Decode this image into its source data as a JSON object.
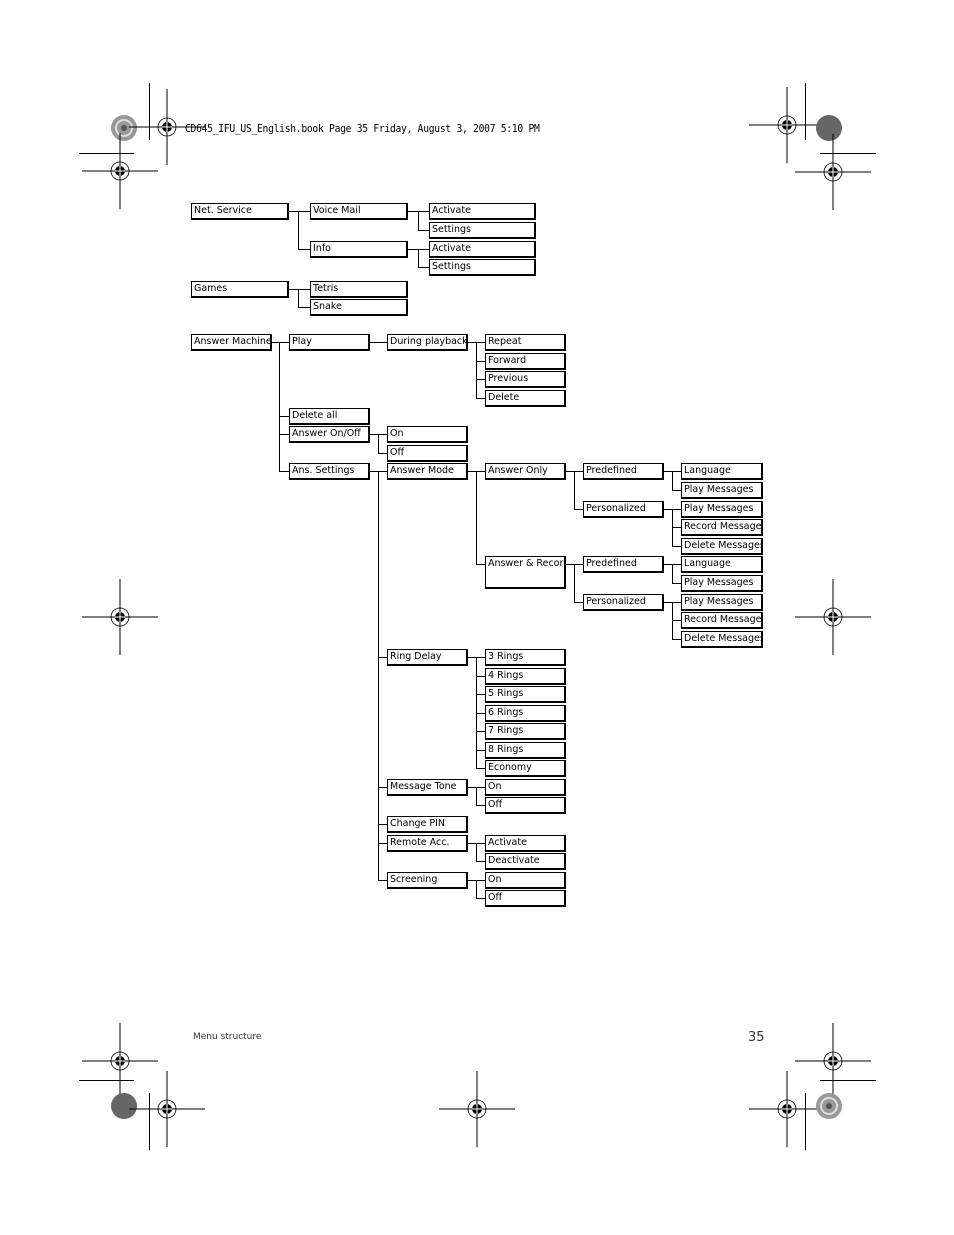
{
  "header": {
    "print_info": "CD645_IFU_US_English.book  Page 35  Friday, August 3, 2007  5:10 PM"
  },
  "menu": {
    "net_service": {
      "label": "Net. Service",
      "voice_mail": {
        "label": "Voice Mail",
        "children": [
          "Activate",
          "Settings"
        ]
      },
      "info": {
        "label": "Info",
        "children": [
          "Activate",
          "Settings"
        ]
      }
    },
    "games": {
      "label": "Games",
      "children": [
        "Tetris",
        "Snake"
      ]
    },
    "answer_machine": {
      "label": "Answer Machine",
      "play": {
        "label": "Play",
        "during_playback": {
          "label": "During playback",
          "children": [
            "Repeat",
            "Forward",
            "Previous",
            "Delete"
          ]
        }
      },
      "delete_all": "Delete all",
      "answer_on_off": {
        "label": "Answer On/Off",
        "children": [
          "On",
          "Off"
        ]
      },
      "ans_settings": {
        "label": "Ans. Settings",
        "answer_mode": {
          "label": "Answer Mode",
          "answer_only": {
            "label": "Answer Only",
            "predefined": {
              "label": "Predefined",
              "children": [
                "Language",
                "Play Messages"
              ]
            },
            "personalized": {
              "label": "Personalized",
              "children": [
                "Play Messages",
                "Record Messages",
                "Delete Messages"
              ]
            }
          },
          "answer_record": {
            "label": "Answer & Record",
            "predefined": {
              "label": "Predefined",
              "children": [
                "Language",
                "Play Messages"
              ]
            },
            "personalized": {
              "label": "Personalized",
              "children": [
                "Play Messages",
                "Record Messages",
                "Delete Messages"
              ]
            }
          }
        },
        "ring_delay": {
          "label": "Ring Delay",
          "children": [
            "3 Rings",
            "4 Rings",
            "5 Rings",
            "6 Rings",
            "7 Rings",
            "8 Rings",
            "Economy"
          ]
        },
        "message_tone": {
          "label": "Message Tone",
          "children": [
            "On",
            "Off"
          ]
        },
        "change_pin": "Change PIN",
        "remote_acc": {
          "label": "Remote Acc.",
          "children": [
            "Activate",
            "Deactivate"
          ]
        },
        "screening": {
          "label": "Screening",
          "children": [
            "On",
            "Off"
          ]
        }
      }
    }
  },
  "footer": {
    "section_title": "Menu structure",
    "page_number": "35"
  }
}
